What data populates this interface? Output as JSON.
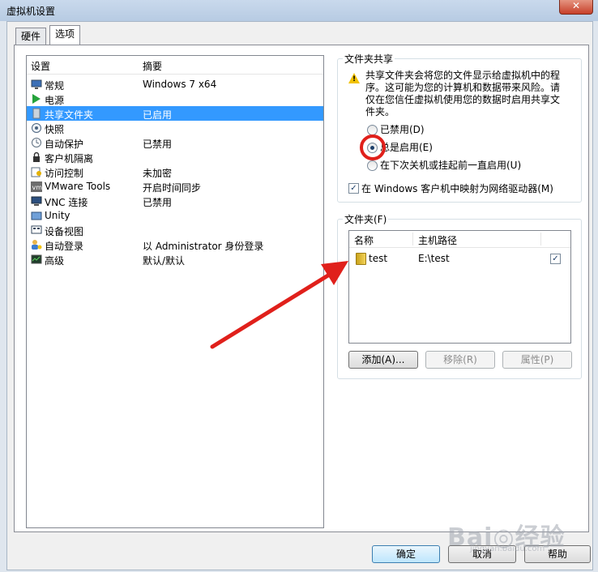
{
  "window": {
    "title": "虚拟机设置",
    "close_label": "✕"
  },
  "tabs": [
    {
      "label": "硬件",
      "active": false
    },
    {
      "label": "选项",
      "active": true
    }
  ],
  "settings_list": {
    "header_setting": "设置",
    "header_summary": "摘要",
    "items": [
      {
        "icon": "monitor-icon",
        "label": "常规",
        "summary": "Windows 7 x64",
        "selected": false
      },
      {
        "icon": "play-icon",
        "label": "电源",
        "summary": "",
        "selected": false
      },
      {
        "icon": "shared-folder-icon",
        "label": "共享文件夹",
        "summary": "已启用",
        "selected": true
      },
      {
        "icon": "snapshot-icon",
        "label": "快照",
        "summary": "",
        "selected": false
      },
      {
        "icon": "autoprotect-icon",
        "label": "自动保护",
        "summary": "已禁用",
        "selected": false
      },
      {
        "icon": "isolation-icon",
        "label": "客户机隔离",
        "summary": "",
        "selected": false
      },
      {
        "icon": "access-control-icon",
        "label": "访问控制",
        "summary": "未加密",
        "selected": false
      },
      {
        "icon": "vmware-tools-icon",
        "label": "VMware Tools",
        "summary": "开启时间同步",
        "selected": false
      },
      {
        "icon": "vnc-icon",
        "label": "VNC 连接",
        "summary": "已禁用",
        "selected": false
      },
      {
        "icon": "unity-icon",
        "label": "Unity",
        "summary": "",
        "selected": false
      },
      {
        "icon": "device-view-icon",
        "label": "设备视图",
        "summary": "",
        "selected": false
      },
      {
        "icon": "autologin-icon",
        "label": "自动登录",
        "summary": "以 Administrator 身份登录",
        "selected": false
      },
      {
        "icon": "advanced-icon",
        "label": "高级",
        "summary": "默认/默认",
        "selected": false
      }
    ]
  },
  "folder_sharing": {
    "title": "文件夹共享",
    "warning": "共享文件夹会将您的文件显示给虚拟机中的程序。这可能为您的计算机和数据带来风险。请仅在您信任虚拟机使用您的数据时启用共享文件夹。",
    "options": [
      {
        "label": "已禁用(D)",
        "checked": false
      },
      {
        "label": "总是启用(E)",
        "checked": true
      },
      {
        "label": "在下次关机或挂起前一直启用(U)",
        "checked": false
      }
    ],
    "map_drive_label": "在 Windows 客户机中映射为网络驱动器(M)",
    "map_drive_checked": true
  },
  "folders": {
    "title": "文件夹(F)",
    "col_name": "名称",
    "col_path": "主机路径",
    "rows": [
      {
        "name": "test",
        "path": "E:\\test",
        "enabled": true
      }
    ],
    "add_label": "添加(A)...",
    "remove_label": "移除(R)",
    "properties_label": "属性(P)"
  },
  "footer": {
    "ok_label": "确定",
    "cancel_label": "取消",
    "help_label": "帮助"
  },
  "annotation_color": "#e0201b",
  "watermark": {
    "main": "Bai◎经验",
    "sub": "jingyan.baidu.com"
  }
}
